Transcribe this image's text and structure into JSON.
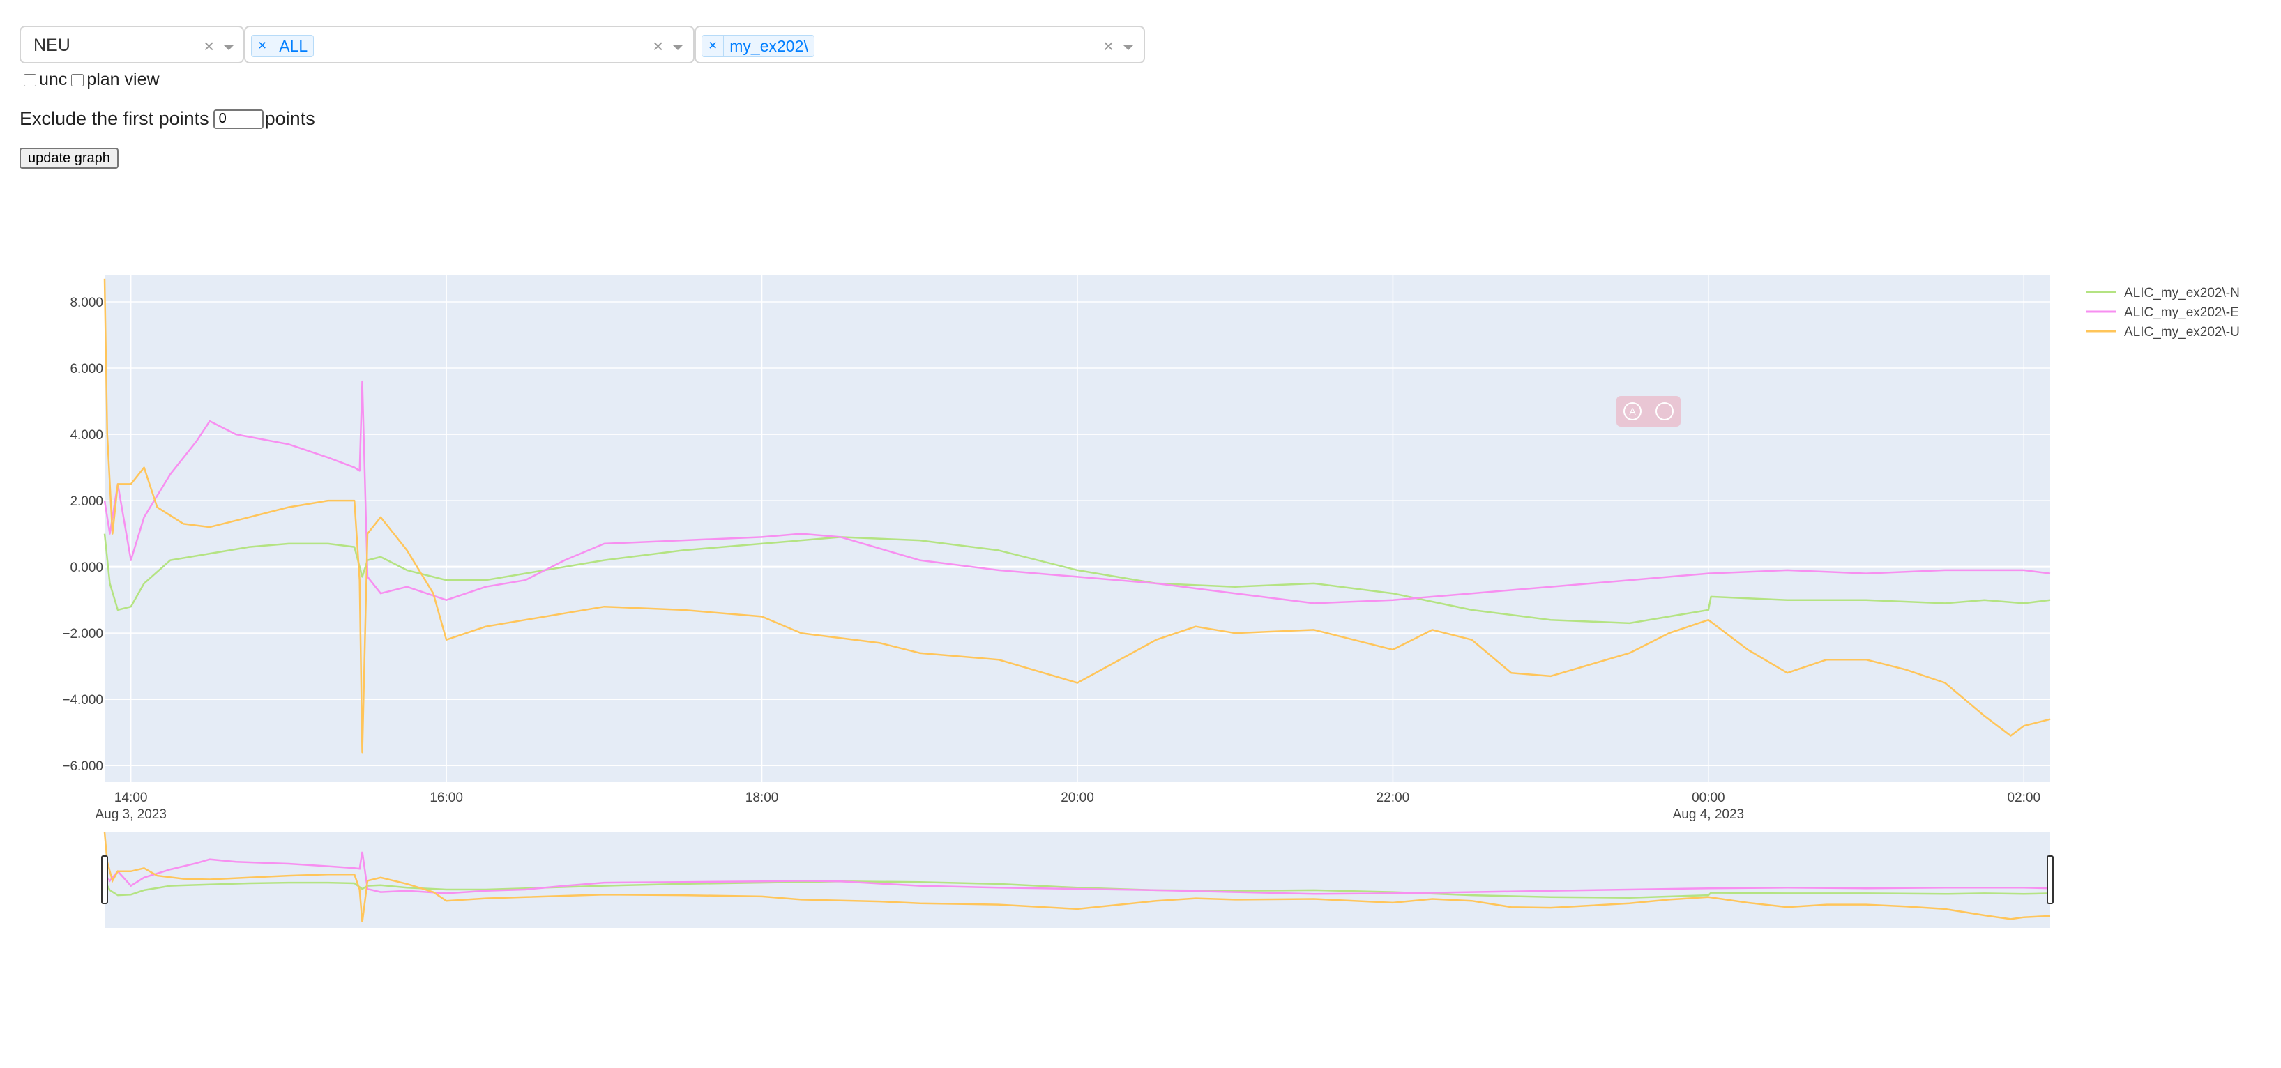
{
  "controls": {
    "component_dropdown": {
      "value": "NEU"
    },
    "site_dropdown": {
      "tag": "ALL"
    },
    "project_dropdown": {
      "tag": "my_ex202\\"
    },
    "clear_symbol": "×",
    "unc_label": "unc",
    "plan_view_label": "plan view",
    "exclude_prefix": "Exclude the first points",
    "exclude_value": "0",
    "exclude_suffix": "points",
    "update_button": "update graph"
  },
  "chart_data": {
    "type": "line",
    "title": "",
    "xlabel": "",
    "ylabel": "",
    "x_range": [
      "2023-08-03 13:50",
      "2023-08-04 02:10"
    ],
    "ylim": [
      -6.5,
      8.8
    ],
    "x_ticks": [
      {
        "t": "2023-08-03 14:00",
        "label": "14:00",
        "sublabel": "Aug 3, 2023"
      },
      {
        "t": "2023-08-03 16:00",
        "label": "16:00",
        "sublabel": ""
      },
      {
        "t": "2023-08-03 18:00",
        "label": "18:00",
        "sublabel": ""
      },
      {
        "t": "2023-08-03 20:00",
        "label": "20:00",
        "sublabel": ""
      },
      {
        "t": "2023-08-03 22:00",
        "label": "22:00",
        "sublabel": ""
      },
      {
        "t": "2023-08-04 00:00",
        "label": "00:00",
        "sublabel": "Aug 4, 2023"
      },
      {
        "t": "2023-08-04 02:00",
        "label": "02:00",
        "sublabel": ""
      }
    ],
    "y_ticks": [
      8,
      6,
      4,
      2,
      0,
      -2,
      -4,
      -6
    ],
    "y_tick_labels": [
      "8.000",
      "6.000",
      "4.000",
      "2.000",
      "0.000",
      "−2.000",
      "−4.000",
      "−6.000"
    ],
    "grid": true,
    "legend_position": "right",
    "rangeslider": true,
    "series": [
      {
        "name": "ALIC_my_ex202\\-N",
        "color": "#b4e382",
        "x": [
          "2023-08-03 13:50",
          "2023-08-03 13:52",
          "2023-08-03 13:55",
          "2023-08-03 14:00",
          "2023-08-03 14:05",
          "2023-08-03 14:15",
          "2023-08-03 14:30",
          "2023-08-03 14:45",
          "2023-08-03 15:00",
          "2023-08-03 15:15",
          "2023-08-03 15:25",
          "2023-08-03 15:28",
          "2023-08-03 15:30",
          "2023-08-03 15:35",
          "2023-08-03 15:45",
          "2023-08-03 16:00",
          "2023-08-03 16:15",
          "2023-08-03 16:30",
          "2023-08-03 17:00",
          "2023-08-03 17:30",
          "2023-08-03 18:00",
          "2023-08-03 18:30",
          "2023-08-03 19:00",
          "2023-08-03 19:30",
          "2023-08-03 20:00",
          "2023-08-03 20:30",
          "2023-08-03 21:00",
          "2023-08-03 21:30",
          "2023-08-03 22:00",
          "2023-08-03 22:30",
          "2023-08-03 23:00",
          "2023-08-03 23:30",
          "2023-08-04 00:00",
          "2023-08-04 00:01",
          "2023-08-04 00:30",
          "2023-08-04 01:00",
          "2023-08-04 01:30",
          "2023-08-04 01:45",
          "2023-08-04 02:00",
          "2023-08-04 02:10"
        ],
        "y": [
          1.0,
          -0.5,
          -1.3,
          -1.2,
          -0.5,
          0.2,
          0.4,
          0.6,
          0.7,
          0.7,
          0.6,
          -0.3,
          0.2,
          0.3,
          -0.1,
          -0.4,
          -0.4,
          -0.2,
          0.2,
          0.5,
          0.7,
          0.9,
          0.8,
          0.5,
          -0.1,
          -0.5,
          -0.6,
          -0.5,
          -0.8,
          -1.3,
          -1.6,
          -1.7,
          -1.3,
          -0.9,
          -1.0,
          -1.0,
          -1.1,
          -1.0,
          -1.1,
          -1.0
        ]
      },
      {
        "name": "ALIC_my_ex202\\-E",
        "color": "#f78ff0",
        "x": [
          "2023-08-03 13:50",
          "2023-08-03 13:52",
          "2023-08-03 13:55",
          "2023-08-03 14:00",
          "2023-08-03 14:05",
          "2023-08-03 14:15",
          "2023-08-03 14:25",
          "2023-08-03 14:30",
          "2023-08-03 14:40",
          "2023-08-03 15:00",
          "2023-08-03 15:15",
          "2023-08-03 15:25",
          "2023-08-03 15:27",
          "2023-08-03 15:28",
          "2023-08-03 15:30",
          "2023-08-03 15:35",
          "2023-08-03 15:45",
          "2023-08-03 16:00",
          "2023-08-03 16:15",
          "2023-08-03 16:30",
          "2023-08-03 16:45",
          "2023-08-03 17:00",
          "2023-08-03 17:30",
          "2023-08-03 18:00",
          "2023-08-03 18:15",
          "2023-08-03 18:30",
          "2023-08-03 19:00",
          "2023-08-03 19:30",
          "2023-08-03 20:00",
          "2023-08-03 20:30",
          "2023-08-03 21:00",
          "2023-08-03 21:30",
          "2023-08-03 22:00",
          "2023-08-03 22:30",
          "2023-08-03 23:00",
          "2023-08-03 23:30",
          "2023-08-04 00:00",
          "2023-08-04 00:30",
          "2023-08-04 01:00",
          "2023-08-04 01:30",
          "2023-08-04 02:00",
          "2023-08-04 02:10"
        ],
        "y": [
          2.0,
          1.0,
          2.5,
          0.2,
          1.5,
          2.8,
          3.8,
          4.4,
          4.0,
          3.7,
          3.3,
          3.0,
          2.9,
          5.6,
          -0.3,
          -0.8,
          -0.6,
          -1.0,
          -0.6,
          -0.4,
          0.2,
          0.7,
          0.8,
          0.9,
          1.0,
          0.9,
          0.2,
          -0.1,
          -0.3,
          -0.5,
          -0.8,
          -1.1,
          -1.0,
          -0.8,
          -0.6,
          -0.4,
          -0.2,
          -0.1,
          -0.2,
          -0.1,
          -0.1,
          -0.2
        ]
      },
      {
        "name": "ALIC_my_ex202\\-U",
        "color": "#ffc55a",
        "x": [
          "2023-08-03 13:50",
          "2023-08-03 13:51",
          "2023-08-03 13:53",
          "2023-08-03 13:55",
          "2023-08-03 14:00",
          "2023-08-03 14:05",
          "2023-08-03 14:10",
          "2023-08-03 14:20",
          "2023-08-03 14:30",
          "2023-08-03 14:45",
          "2023-08-03 15:00",
          "2023-08-03 15:15",
          "2023-08-03 15:25",
          "2023-08-03 15:27",
          "2023-08-03 15:28",
          "2023-08-03 15:30",
          "2023-08-03 15:35",
          "2023-08-03 15:45",
          "2023-08-03 15:55",
          "2023-08-03 16:00",
          "2023-08-03 16:15",
          "2023-08-03 16:30",
          "2023-08-03 17:00",
          "2023-08-03 17:30",
          "2023-08-03 18:00",
          "2023-08-03 18:15",
          "2023-08-03 18:45",
          "2023-08-03 19:00",
          "2023-08-03 19:30",
          "2023-08-03 20:00",
          "2023-08-03 20:30",
          "2023-08-03 20:45",
          "2023-08-03 21:00",
          "2023-08-03 21:30",
          "2023-08-03 22:00",
          "2023-08-03 22:15",
          "2023-08-03 22:30",
          "2023-08-03 22:45",
          "2023-08-03 23:00",
          "2023-08-03 23:30",
          "2023-08-03 23:45",
          "2023-08-04 00:00",
          "2023-08-04 00:15",
          "2023-08-04 00:30",
          "2023-08-04 00:45",
          "2023-08-04 01:00",
          "2023-08-04 01:15",
          "2023-08-04 01:30",
          "2023-08-04 01:45",
          "2023-08-04 01:55",
          "2023-08-04 02:00",
          "2023-08-04 02:10"
        ],
        "y": [
          8.7,
          4.0,
          1.0,
          2.5,
          2.5,
          3.0,
          1.8,
          1.3,
          1.2,
          1.5,
          1.8,
          2.0,
          2.0,
          -0.4,
          -5.6,
          1.0,
          1.5,
          0.5,
          -0.8,
          -2.2,
          -1.8,
          -1.6,
          -1.2,
          -1.3,
          -1.5,
          -2.0,
          -2.3,
          -2.6,
          -2.8,
          -3.5,
          -2.2,
          -1.8,
          -2.0,
          -1.9,
          -2.5,
          -1.9,
          -2.2,
          -3.2,
          -3.3,
          -2.6,
          -2.0,
          -1.6,
          -2.5,
          -3.2,
          -2.8,
          -2.8,
          -3.1,
          -3.5,
          -4.5,
          -5.1,
          -4.8,
          -4.6
        ]
      }
    ]
  }
}
